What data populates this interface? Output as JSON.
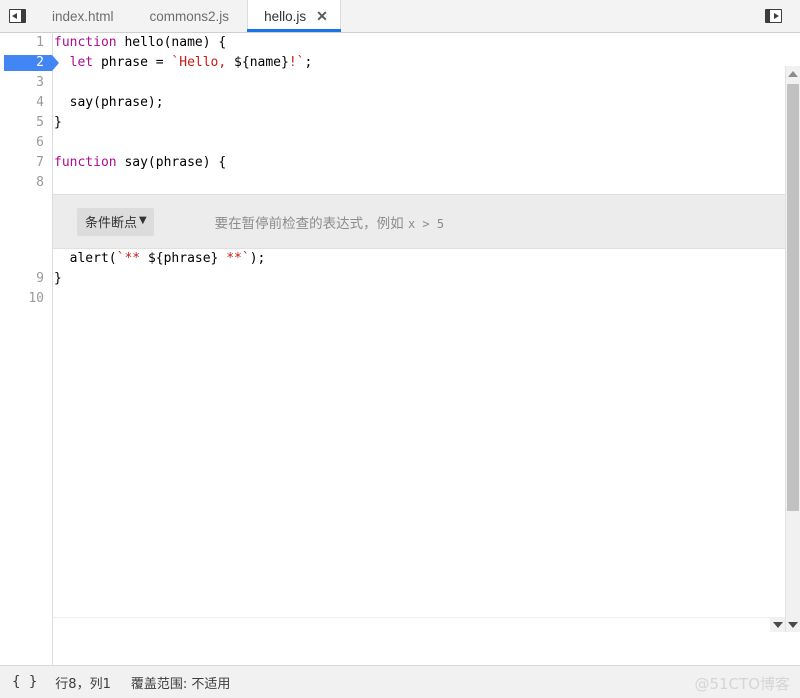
{
  "toolbar": {
    "left_panel_icon": "panel-left-icon",
    "right_panel_icon": "panel-right-icon"
  },
  "tabs": [
    {
      "label": "index.html",
      "active": false,
      "closable": false
    },
    {
      "label": "commons2.js",
      "active": false,
      "closable": false
    },
    {
      "label": "hello.js",
      "active": true,
      "closable": true,
      "close_glyph": "✕"
    }
  ],
  "editor": {
    "lines": [
      {
        "num": "1",
        "breakpoint": false,
        "segments": [
          {
            "t": "function",
            "c": "kw"
          },
          {
            "t": " hello(name) {",
            "c": "plain"
          }
        ]
      },
      {
        "num": "2",
        "breakpoint": true,
        "segments": [
          {
            "t": "  ",
            "c": "plain"
          },
          {
            "t": "let",
            "c": "kw"
          },
          {
            "t": " phrase = ",
            "c": "plain"
          },
          {
            "t": "`Hello, ",
            "c": "str"
          },
          {
            "t": "${name}",
            "c": "plain"
          },
          {
            "t": "!`",
            "c": "str"
          },
          {
            "t": ";",
            "c": "plain"
          }
        ]
      },
      {
        "num": "3",
        "breakpoint": false,
        "segments": [
          {
            "t": "",
            "c": "plain"
          }
        ]
      },
      {
        "num": "4",
        "breakpoint": false,
        "segments": [
          {
            "t": "  say(phrase);",
            "c": "plain"
          }
        ]
      },
      {
        "num": "5",
        "breakpoint": false,
        "segments": [
          {
            "t": "}",
            "c": "plain"
          }
        ]
      },
      {
        "num": "6",
        "breakpoint": false,
        "segments": [
          {
            "t": "",
            "c": "plain"
          }
        ]
      },
      {
        "num": "7",
        "breakpoint": false,
        "segments": [
          {
            "t": "function",
            "c": "kw"
          },
          {
            "t": " say(phrase) {",
            "c": "plain"
          }
        ]
      },
      {
        "num": "8",
        "breakpoint": false,
        "segments": [
          {
            "t": "",
            "c": "plain"
          }
        ]
      }
    ],
    "lines_after": [
      {
        "num": "",
        "breakpoint": false,
        "segments": [
          {
            "t": "  alert(",
            "c": "plain"
          },
          {
            "t": "`** ",
            "c": "str"
          },
          {
            "t": "${phrase}",
            "c": "plain"
          },
          {
            "t": " **`",
            "c": "str"
          },
          {
            "t": ");",
            "c": "plain"
          }
        ]
      },
      {
        "num": "9",
        "breakpoint": false,
        "segments": [
          {
            "t": "}",
            "c": "plain"
          }
        ]
      },
      {
        "num": "10",
        "breakpoint": false,
        "segments": [
          {
            "t": "",
            "c": "plain"
          }
        ]
      }
    ]
  },
  "conditional_breakpoint": {
    "select_label": "条件断点",
    "caret_glyph": "▼",
    "input_value": "",
    "input_placeholder": "要在暂停前检查的表达式，例如 ",
    "input_placeholder_expr": "x > 5"
  },
  "statusbar": {
    "format_icon": "{ }",
    "position": "行8，列1",
    "coverage": "覆盖范围: 不适用"
  },
  "watermark": {
    "text": "@51CTO博客"
  },
  "colors": {
    "accent": "#1a73e8",
    "breakpoint": "#4285f4",
    "keyword": "#aa0d91",
    "string": "#c41a16",
    "tab_bar_bg": "#f3f3f3",
    "widget_bg": "#ececec",
    "statusbar_bg": "#f1f1f1"
  }
}
